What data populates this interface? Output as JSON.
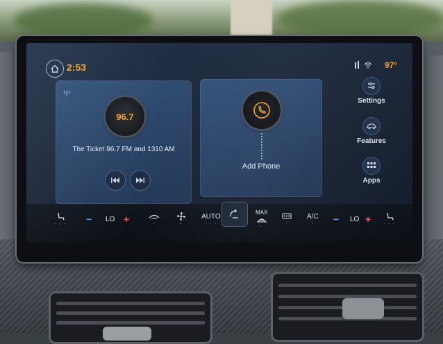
{
  "status_bar": {
    "time": "2:53",
    "temperature": "97°"
  },
  "radio": {
    "frequency": "96.7",
    "station_text": "The Ticket 96.7 FM and 1310 AM"
  },
  "phone": {
    "add_label": "Add Phone"
  },
  "sidebar": {
    "items": [
      {
        "label": "Settings",
        "icon": "settings-sliders-icon"
      },
      {
        "label": "Features",
        "icon": "car-icon"
      },
      {
        "label": "Apps",
        "icon": "apps-grid-icon"
      }
    ]
  },
  "climate": {
    "driver_temp": "LO",
    "passenger_temp": "LO",
    "auto_label": "AUTO",
    "max_label": "MAX",
    "ac_label": "A/C",
    "minus": "−",
    "plus": "+"
  },
  "colors": {
    "accent": "#f5a623",
    "temp_down": "#4aa3ff",
    "temp_up": "#ff4d4d"
  }
}
